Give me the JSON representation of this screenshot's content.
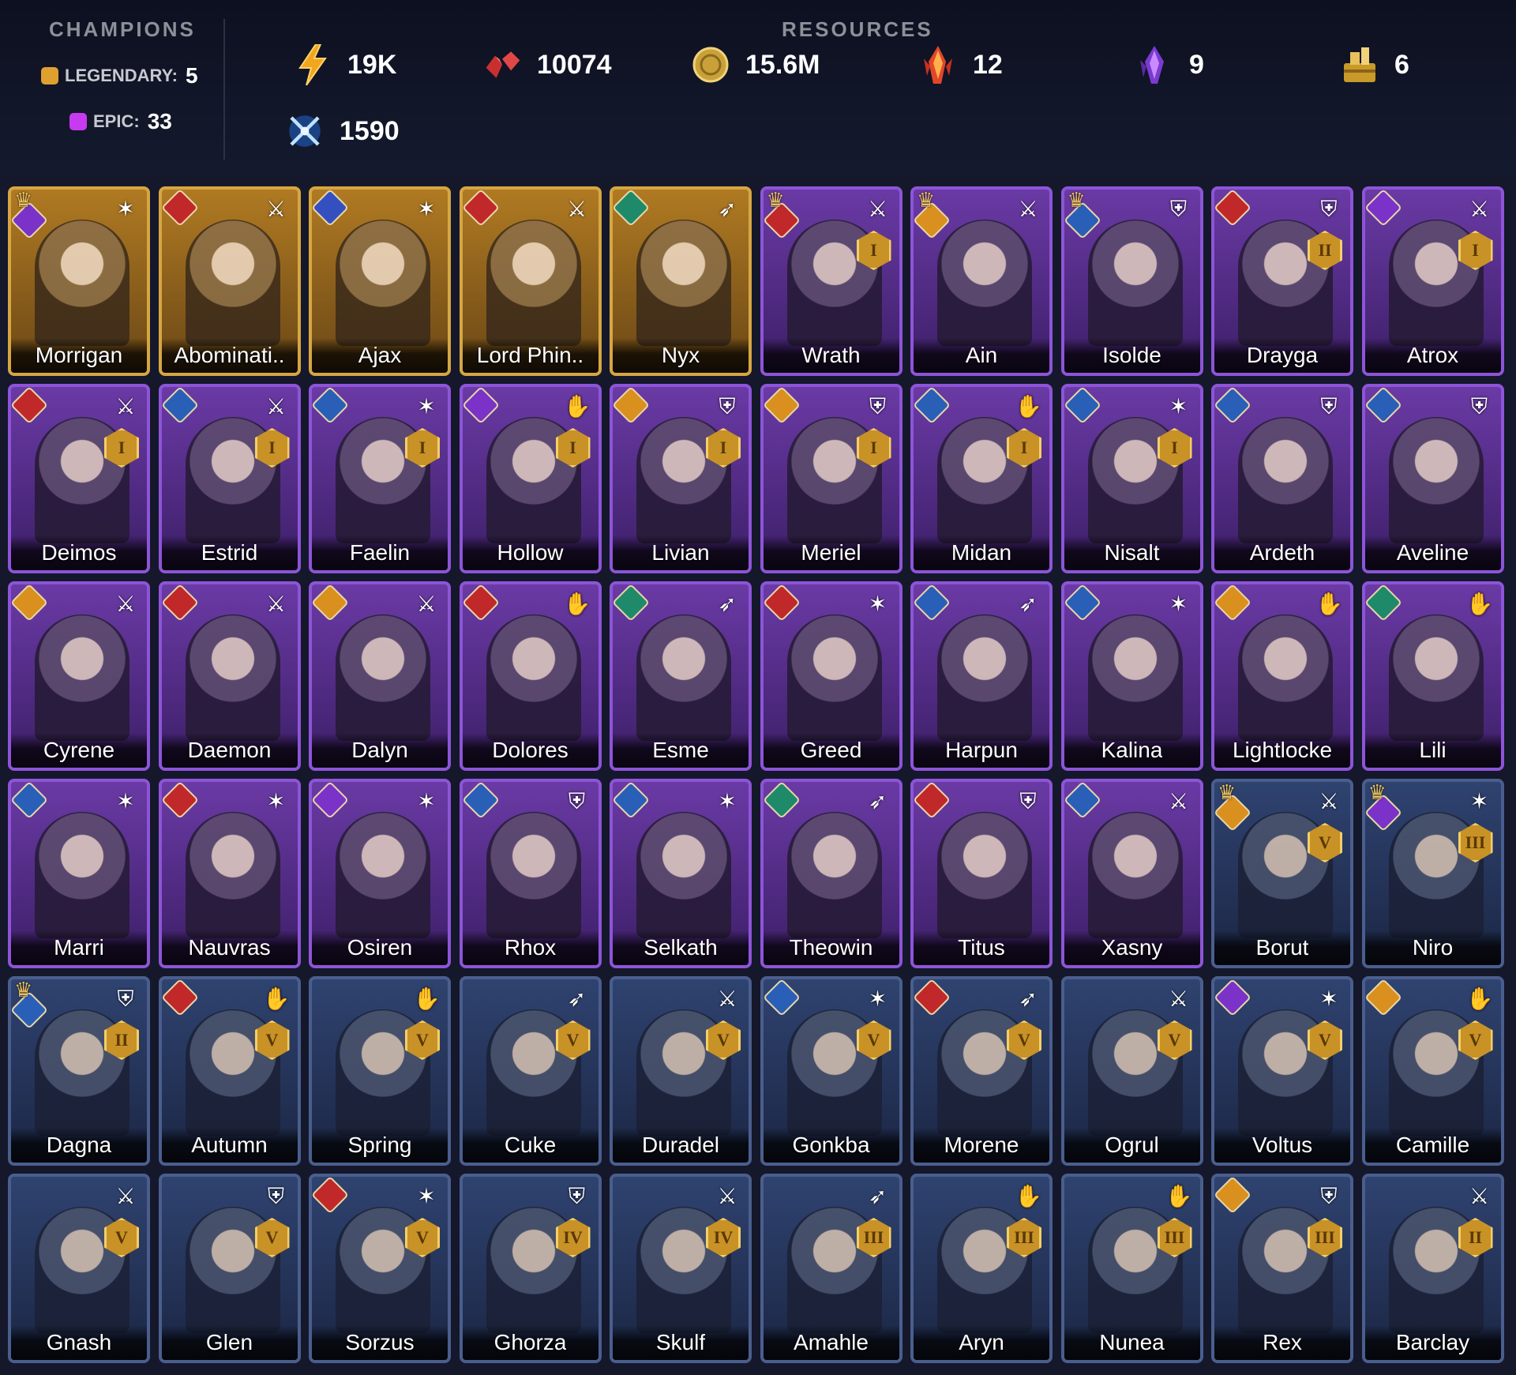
{
  "header": {
    "champions_title": "CHAMPIONS",
    "resources_title": "RESOURCES",
    "legendary": {
      "label": "LEGENDARY:",
      "count": "5",
      "color": "#e0a030"
    },
    "epic": {
      "label": "EPIC:",
      "count": "33",
      "color": "#c63bf0"
    },
    "resources": [
      {
        "icon": "energy-icon",
        "value": "19K"
      },
      {
        "icon": "gem-icon",
        "value": "10074"
      },
      {
        "icon": "silver-coin-icon",
        "value": "15.6M"
      },
      {
        "icon": "fire-shard-icon",
        "value": "12"
      },
      {
        "icon": "void-shard-icon",
        "value": "9"
      },
      {
        "icon": "treasure-icon",
        "value": "6"
      },
      {
        "icon": "arena-token-icon",
        "value": "1590"
      }
    ]
  },
  "colors": {
    "legendary": "#d6a642",
    "epic": "#8d54d8",
    "rare": "#4a5e8e",
    "background": "#14182a"
  },
  "champions": [
    {
      "name": "Morrigan",
      "rarity": "legendary",
      "role": "magic",
      "faction": "void",
      "crown": true,
      "rank": ""
    },
    {
      "name": "Abominati..",
      "rarity": "legendary",
      "role": "sword",
      "faction": "fire",
      "crown": false,
      "rank": ""
    },
    {
      "name": "Ajax",
      "rarity": "legendary",
      "role": "magic",
      "faction": "void-blue",
      "crown": false,
      "rank": ""
    },
    {
      "name": "Lord Phin..",
      "rarity": "legendary",
      "role": "sword",
      "faction": "fire",
      "crown": false,
      "rank": ""
    },
    {
      "name": "Nyx",
      "rarity": "legendary",
      "role": "ranged",
      "faction": "nature",
      "crown": false,
      "rank": ""
    },
    {
      "name": "Wrath",
      "rarity": "epic",
      "role": "sword",
      "faction": "fire",
      "crown": true,
      "rank": "I"
    },
    {
      "name": "Ain",
      "rarity": "epic",
      "role": "sword",
      "faction": "light",
      "crown": true,
      "rank": ""
    },
    {
      "name": "Isolde",
      "rarity": "epic",
      "role": "shield",
      "faction": "water",
      "crown": true,
      "rank": ""
    },
    {
      "name": "Drayga",
      "rarity": "epic",
      "role": "shield",
      "faction": "fire",
      "crown": false,
      "rank": "II"
    },
    {
      "name": "Atrox",
      "rarity": "epic",
      "role": "sword",
      "faction": "void",
      "crown": false,
      "rank": "I"
    },
    {
      "name": "Deimos",
      "rarity": "epic",
      "role": "sword",
      "faction": "fire",
      "crown": false,
      "rank": "I"
    },
    {
      "name": "Estrid",
      "rarity": "epic",
      "role": "sword",
      "faction": "water",
      "crown": false,
      "rank": "I"
    },
    {
      "name": "Faelin",
      "rarity": "epic",
      "role": "magic",
      "faction": "water",
      "crown": false,
      "rank": "I"
    },
    {
      "name": "Hollow",
      "rarity": "epic",
      "role": "support",
      "faction": "void",
      "crown": false,
      "rank": "I"
    },
    {
      "name": "Livian",
      "rarity": "epic",
      "role": "shield",
      "faction": "light",
      "crown": false,
      "rank": "I"
    },
    {
      "name": "Meriel",
      "rarity": "epic",
      "role": "shield",
      "faction": "light",
      "crown": false,
      "rank": "I"
    },
    {
      "name": "Midan",
      "rarity": "epic",
      "role": "support",
      "faction": "water",
      "crown": false,
      "rank": "I"
    },
    {
      "name": "Nisalt",
      "rarity": "epic",
      "role": "magic",
      "faction": "water",
      "crown": false,
      "rank": "I"
    },
    {
      "name": "Ardeth",
      "rarity": "epic",
      "role": "shield",
      "faction": "water",
      "crown": false,
      "rank": ""
    },
    {
      "name": "Aveline",
      "rarity": "epic",
      "role": "shield",
      "faction": "water",
      "crown": false,
      "rank": ""
    },
    {
      "name": "Cyrene",
      "rarity": "epic",
      "role": "sword",
      "faction": "light",
      "crown": false,
      "rank": ""
    },
    {
      "name": "Daemon",
      "rarity": "epic",
      "role": "sword",
      "faction": "fire",
      "crown": false,
      "rank": ""
    },
    {
      "name": "Dalyn",
      "rarity": "epic",
      "role": "sword",
      "faction": "light",
      "crown": false,
      "rank": ""
    },
    {
      "name": "Dolores",
      "rarity": "epic",
      "role": "support",
      "faction": "fire",
      "crown": false,
      "rank": ""
    },
    {
      "name": "Esme",
      "rarity": "epic",
      "role": "ranged",
      "faction": "nature",
      "crown": false,
      "rank": ""
    },
    {
      "name": "Greed",
      "rarity": "epic",
      "role": "magic",
      "faction": "fire",
      "crown": false,
      "rank": ""
    },
    {
      "name": "Harpun",
      "rarity": "epic",
      "role": "ranged",
      "faction": "water",
      "crown": false,
      "rank": ""
    },
    {
      "name": "Kalina",
      "rarity": "epic",
      "role": "magic",
      "faction": "water",
      "crown": false,
      "rank": ""
    },
    {
      "name": "Lightlocke",
      "rarity": "epic",
      "role": "support",
      "faction": "light",
      "crown": false,
      "rank": ""
    },
    {
      "name": "Lili",
      "rarity": "epic",
      "role": "support",
      "faction": "nature",
      "crown": false,
      "rank": ""
    },
    {
      "name": "Marri",
      "rarity": "epic",
      "role": "magic",
      "faction": "water",
      "crown": false,
      "rank": ""
    },
    {
      "name": "Nauvras",
      "rarity": "epic",
      "role": "magic",
      "faction": "fire",
      "crown": false,
      "rank": ""
    },
    {
      "name": "Osiren",
      "rarity": "epic",
      "role": "magic",
      "faction": "void",
      "crown": false,
      "rank": ""
    },
    {
      "name": "Rhox",
      "rarity": "epic",
      "role": "shield",
      "faction": "water",
      "crown": false,
      "rank": ""
    },
    {
      "name": "Selkath",
      "rarity": "epic",
      "role": "magic",
      "faction": "water",
      "crown": false,
      "rank": ""
    },
    {
      "name": "Theowin",
      "rarity": "epic",
      "role": "ranged",
      "faction": "nature",
      "crown": false,
      "rank": ""
    },
    {
      "name": "Titus",
      "rarity": "epic",
      "role": "shield",
      "faction": "fire",
      "crown": false,
      "rank": ""
    },
    {
      "name": "Xasny",
      "rarity": "epic",
      "role": "sword",
      "faction": "water",
      "crown": false,
      "rank": ""
    },
    {
      "name": "Borut",
      "rarity": "rare",
      "role": "sword",
      "faction": "light",
      "crown": true,
      "rank": "V"
    },
    {
      "name": "Niro",
      "rarity": "rare",
      "role": "magic",
      "faction": "void",
      "crown": true,
      "rank": "III"
    },
    {
      "name": "Dagna",
      "rarity": "rare",
      "role": "shield",
      "faction": "water",
      "crown": true,
      "rank": "II"
    },
    {
      "name": "Autumn",
      "rarity": "rare",
      "role": "support",
      "faction": "fire",
      "crown": false,
      "rank": "V"
    },
    {
      "name": "Spring",
      "rarity": "rare",
      "role": "support",
      "faction": "",
      "crown": false,
      "rank": "V"
    },
    {
      "name": "Cuke",
      "rarity": "rare",
      "role": "ranged",
      "faction": "",
      "crown": false,
      "rank": "V"
    },
    {
      "name": "Duradel",
      "rarity": "rare",
      "role": "sword",
      "faction": "",
      "crown": false,
      "rank": "V"
    },
    {
      "name": "Gonkba",
      "rarity": "rare",
      "role": "magic",
      "faction": "water",
      "crown": false,
      "rank": "V"
    },
    {
      "name": "Morene",
      "rarity": "rare",
      "role": "ranged",
      "faction": "fire",
      "crown": false,
      "rank": "V"
    },
    {
      "name": "Ogrul",
      "rarity": "rare",
      "role": "sword",
      "faction": "",
      "crown": false,
      "rank": "V"
    },
    {
      "name": "Voltus",
      "rarity": "rare",
      "role": "magic",
      "faction": "void",
      "crown": false,
      "rank": "V"
    },
    {
      "name": "Camille",
      "rarity": "rare",
      "role": "support",
      "faction": "light",
      "crown": false,
      "rank": "V"
    },
    {
      "name": "Gnash",
      "rarity": "rare",
      "role": "sword",
      "faction": "",
      "crown": false,
      "rank": "V"
    },
    {
      "name": "Glen",
      "rarity": "rare",
      "role": "shield",
      "faction": "",
      "crown": false,
      "rank": "V"
    },
    {
      "name": "Sorzus",
      "rarity": "rare",
      "role": "magic",
      "faction": "fire",
      "crown": false,
      "rank": "V"
    },
    {
      "name": "Ghorza",
      "rarity": "rare",
      "role": "shield",
      "faction": "",
      "crown": false,
      "rank": "IV"
    },
    {
      "name": "Skulf",
      "rarity": "rare",
      "role": "sword",
      "faction": "",
      "crown": false,
      "rank": "IV"
    },
    {
      "name": "Amahle",
      "rarity": "rare",
      "role": "ranged",
      "faction": "",
      "crown": false,
      "rank": "III"
    },
    {
      "name": "Aryn",
      "rarity": "rare",
      "role": "support",
      "faction": "",
      "crown": false,
      "rank": "III"
    },
    {
      "name": "Nunea",
      "rarity": "rare",
      "role": "support",
      "faction": "",
      "crown": false,
      "rank": "III"
    },
    {
      "name": "Rex",
      "rarity": "rare",
      "role": "shield",
      "faction": "light",
      "crown": false,
      "rank": "III"
    },
    {
      "name": "Barclay",
      "rarity": "rare",
      "role": "sword",
      "faction": "",
      "crown": false,
      "rank": "II"
    }
  ]
}
